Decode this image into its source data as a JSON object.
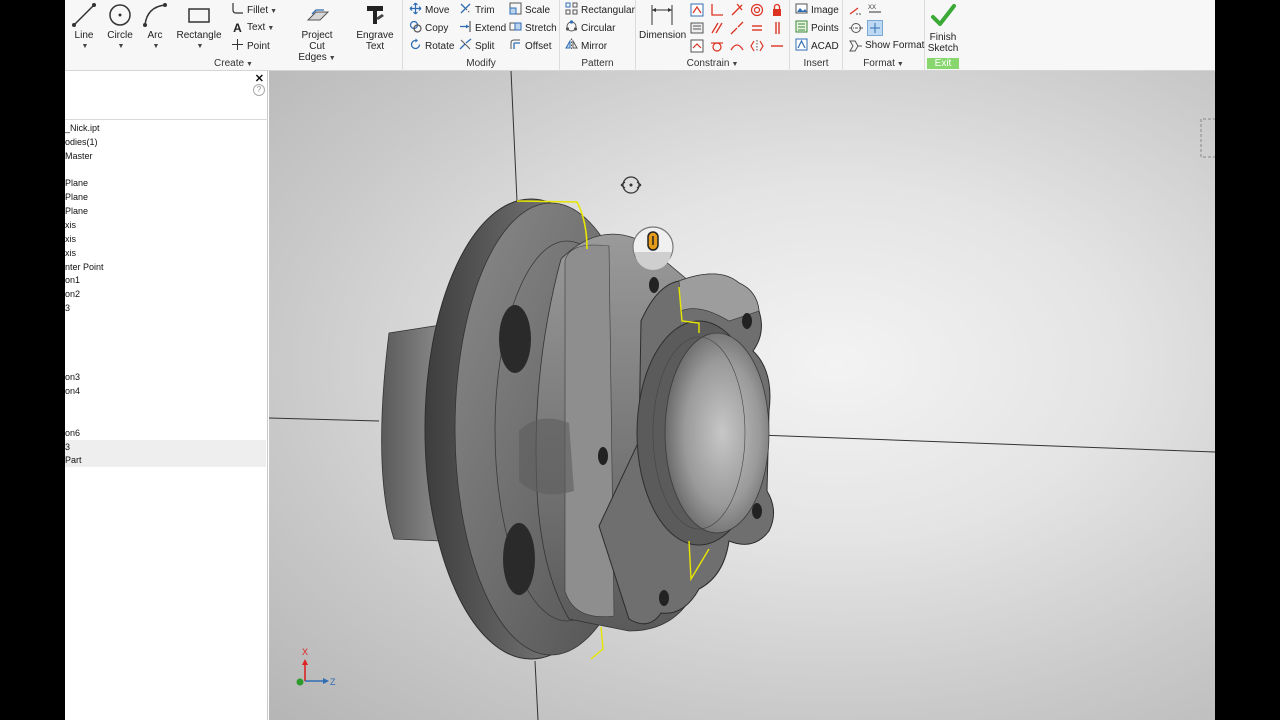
{
  "ribbon": {
    "create": {
      "label": "Create",
      "line": "Line",
      "circle": "Circle",
      "arc": "Arc",
      "rectangle": "Rectangle",
      "fillet": "Fillet",
      "text": "Text",
      "point": "Point",
      "project_cut_edges": "Project",
      "project_cut_edges_2": "Cut Edges",
      "engrave_text": "Engrave Text"
    },
    "modify": {
      "label": "Modify",
      "move": "Move",
      "copy": "Copy",
      "rotate": "Rotate",
      "trim": "Trim",
      "extend": "Extend",
      "split": "Split",
      "scale": "Scale",
      "stretch": "Stretch",
      "offset": "Offset"
    },
    "pattern": {
      "label": "Pattern",
      "rectangular": "Rectangular",
      "circular": "Circular",
      "mirror": "Mirror"
    },
    "constrain": {
      "label": "Constrain",
      "dimension": "Dimension"
    },
    "insert": {
      "label": "Insert",
      "image": "Image",
      "points": "Points",
      "acad": "ACAD"
    },
    "format": {
      "label": "Format",
      "show_format": "Show Format"
    },
    "exit": {
      "label": "Exit",
      "finish": "Finish",
      "sketch": "Sketch"
    }
  },
  "browser": {
    "rows": [
      "_Nick.ipt",
      "odies(1)",
      "Master",
      "",
      "Plane",
      "Plane",
      "Plane",
      "xis",
      "xis",
      "xis",
      "nter Point",
      "on1",
      "on2",
      "3",
      "",
      "",
      "",
      "",
      "on3",
      "on4",
      "",
      "",
      "on6",
      "3",
      "Part"
    ]
  },
  "triad": {
    "x": "X",
    "z": "Z"
  },
  "colors": {
    "exit_green": "#88d66e",
    "accent_blue": "#2f6db5",
    "edge_yellow": "#e6e600"
  }
}
